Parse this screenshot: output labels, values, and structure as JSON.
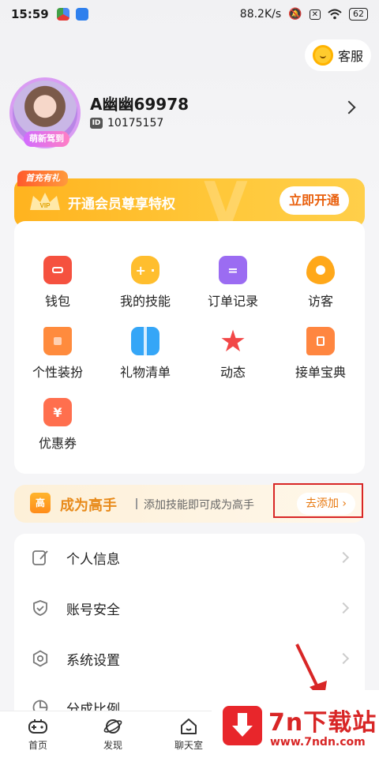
{
  "status_bar": {
    "time": "15:59",
    "network_speed": "88.2K/s",
    "battery": "62"
  },
  "customer_service": {
    "label": "客服"
  },
  "profile": {
    "username": "A幽幽69978",
    "id_tag": "ID",
    "user_id": "10175157",
    "avatar_badge": "萌新驾到"
  },
  "vip": {
    "tag": "首充有礼",
    "text": "开通会员尊享特权",
    "button": "立即开通",
    "watermark": "V"
  },
  "features": [
    {
      "label": "钱包",
      "icon": "wallet-icon",
      "color": "#f5513f"
    },
    {
      "label": "我的技能",
      "icon": "gamepad-icon",
      "color": "#ffbe2e"
    },
    {
      "label": "订单记录",
      "icon": "clipboard-icon",
      "color": "#9b6cf2"
    },
    {
      "label": "访客",
      "icon": "eye-icon",
      "color": "#ffa81a"
    },
    {
      "label": "个性装扮",
      "icon": "tshirt-icon",
      "color": "#ff8b3d"
    },
    {
      "label": "礼物清单",
      "icon": "gift-icon",
      "color": "#35a6f7"
    },
    {
      "label": "动态",
      "icon": "star-icon",
      "color": "#f24747"
    },
    {
      "label": "接单宝典",
      "icon": "book-icon",
      "color": "#ff8640"
    },
    {
      "label": "优惠券",
      "icon": "coupon-icon",
      "color": "#ff6f4e",
      "glyph": "¥"
    }
  ],
  "expert_banner": {
    "badge": "高",
    "title": "成为高手",
    "desc": "添加技能即可成为高手",
    "button": "去添加 ›"
  },
  "settings": [
    {
      "label": "个人信息",
      "icon": "edit-icon"
    },
    {
      "label": "账号安全",
      "icon": "shield-icon"
    },
    {
      "label": "系统设置",
      "icon": "settings-icon"
    },
    {
      "label": "分成比例",
      "icon": "pie-chart-icon"
    }
  ],
  "tabs": [
    {
      "label": "首页",
      "icon": "gamepad-tab-icon"
    },
    {
      "label": "发现",
      "icon": "planet-icon"
    },
    {
      "label": "聊天室",
      "icon": "home-chat-icon"
    }
  ],
  "watermark": {
    "name": "7n下载站",
    "url": "www.7ndn.com"
  }
}
